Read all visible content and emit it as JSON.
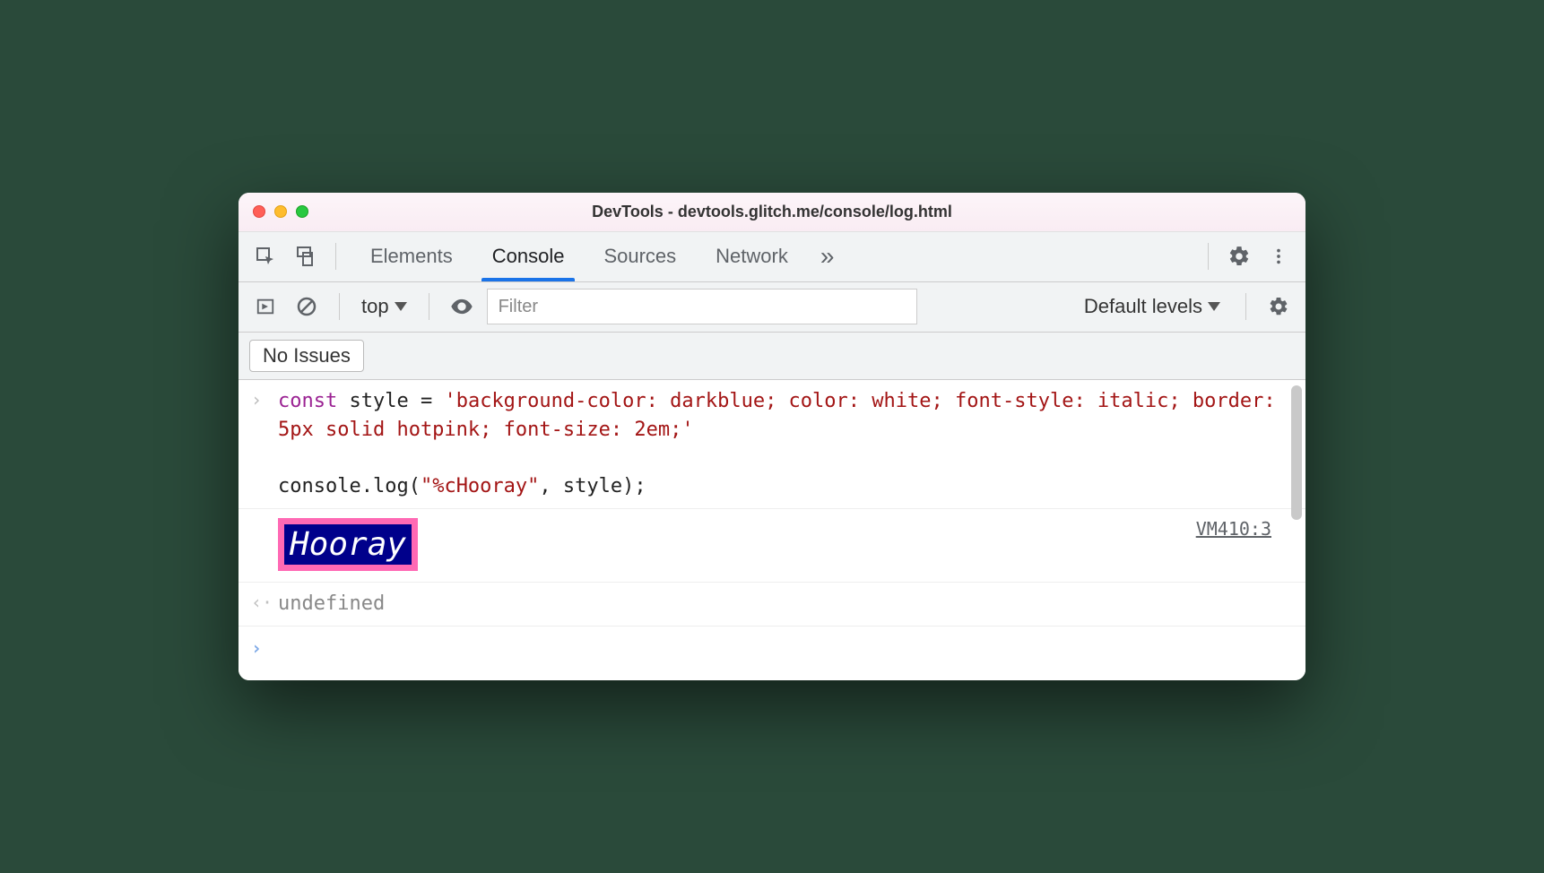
{
  "window": {
    "title": "DevTools - devtools.glitch.me/console/log.html"
  },
  "tabs": {
    "items": [
      "Elements",
      "Console",
      "Sources",
      "Network"
    ],
    "active_index": 1
  },
  "subtoolbar": {
    "context": "top",
    "filter_placeholder": "Filter",
    "levels_label": "Default levels"
  },
  "issues": {
    "badge": "No Issues"
  },
  "console": {
    "input": {
      "keyword": "const",
      "var_and_eq": " style = ",
      "string": "'background-color: darkblue; color: white; font-style: italic; border: 5px solid hotpink; font-size: 2em;'",
      "blank": "",
      "call_pre": "console.log(",
      "call_arg1": "\"%cHooray\"",
      "call_mid": ", style);"
    },
    "output": {
      "styled_text": "Hooray",
      "source": "VM410:3"
    },
    "return_value": "undefined"
  },
  "colors": {
    "accent": "#1a73e8",
    "hotpink": "#ff69b4",
    "darkblue": "#00008b"
  }
}
